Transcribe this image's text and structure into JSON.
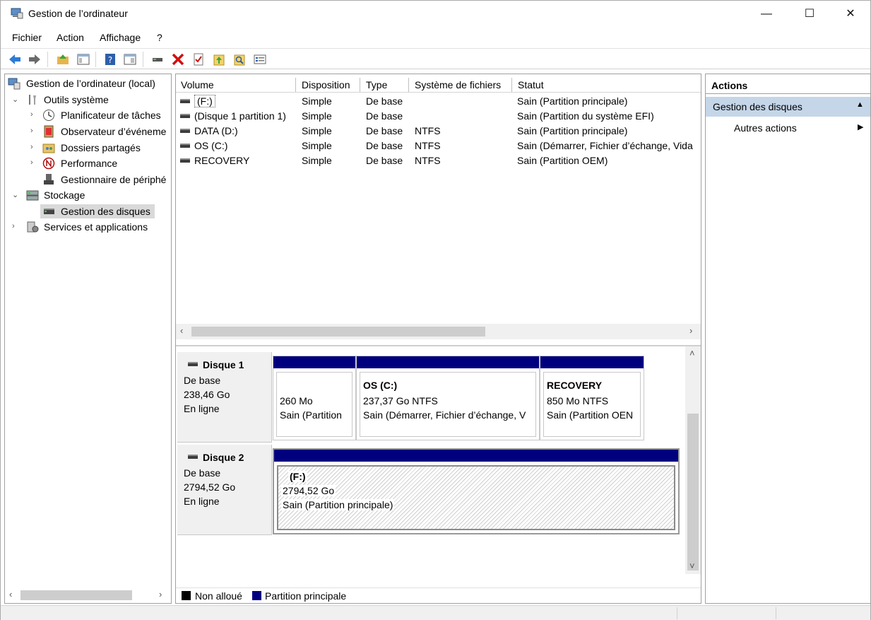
{
  "window": {
    "title": "Gestion de l’ordinateur",
    "minimize": "—",
    "maximize": "☐",
    "close": "✕"
  },
  "menu": [
    "Fichier",
    "Action",
    "Affichage",
    "?"
  ],
  "tree": {
    "root": "Gestion de l’ordinateur (local)",
    "outils": "Outils système",
    "planificateur": "Planificateur de tâches",
    "observateur": "Observateur d’événeme",
    "dossiers": "Dossiers partagés",
    "performance": "Performance",
    "gestionnaire": "Gestionnaire de périphé",
    "stockage": "Stockage",
    "gestion_disques": "Gestion des disques",
    "services": "Services et applications"
  },
  "volumes": {
    "headers": [
      "Volume",
      "Disposition",
      "Type",
      "Système de fichiers",
      "Statut"
    ],
    "rows": [
      [
        "(F:)",
        "Simple",
        "De base",
        "",
        "Sain (Partition principale)"
      ],
      [
        "(Disque 1 partition 1)",
        "Simple",
        "De base",
        "",
        "Sain (Partition du système EFI)"
      ],
      [
        "DATA (D:)",
        "Simple",
        "De base",
        "NTFS",
        "Sain (Partition principale)"
      ],
      [
        "OS (C:)",
        "Simple",
        "De base",
        "NTFS",
        "Sain (Démarrer, Fichier d’échange, Vida"
      ],
      [
        "RECOVERY",
        "Simple",
        "De base",
        "NTFS",
        "Sain (Partition OEM)"
      ]
    ]
  },
  "disks": [
    {
      "name": "Disque 1",
      "type": "De base",
      "size": "238,46 Go",
      "state": "En ligne",
      "partitions": [
        {
          "title": "",
          "size": "260 Mo",
          "status": "Sain (Partition"
        },
        {
          "title": "OS  (C:)",
          "size": "237,37 Go NTFS",
          "status": "Sain (Démarrer, Fichier d’échange, V"
        },
        {
          "title": "RECOVERY",
          "size": "850 Mo NTFS",
          "status": "Sain (Partition OEN"
        }
      ]
    },
    {
      "name": "Disque 2",
      "type": "De base",
      "size": "2794,52 Go",
      "state": "En ligne",
      "partitions": [
        {
          "title": "(F:)",
          "size": "2794,52 Go",
          "status": "Sain (Partition principale)"
        }
      ]
    }
  ],
  "legend": {
    "unalloc": "Non alloué",
    "primary": "Partition principale"
  },
  "actions": {
    "title": "Actions",
    "section": "Gestion des disques",
    "more": "Autres actions"
  },
  "colors": {
    "partition_header": "#00007f",
    "selection": "#c4d6e8"
  }
}
